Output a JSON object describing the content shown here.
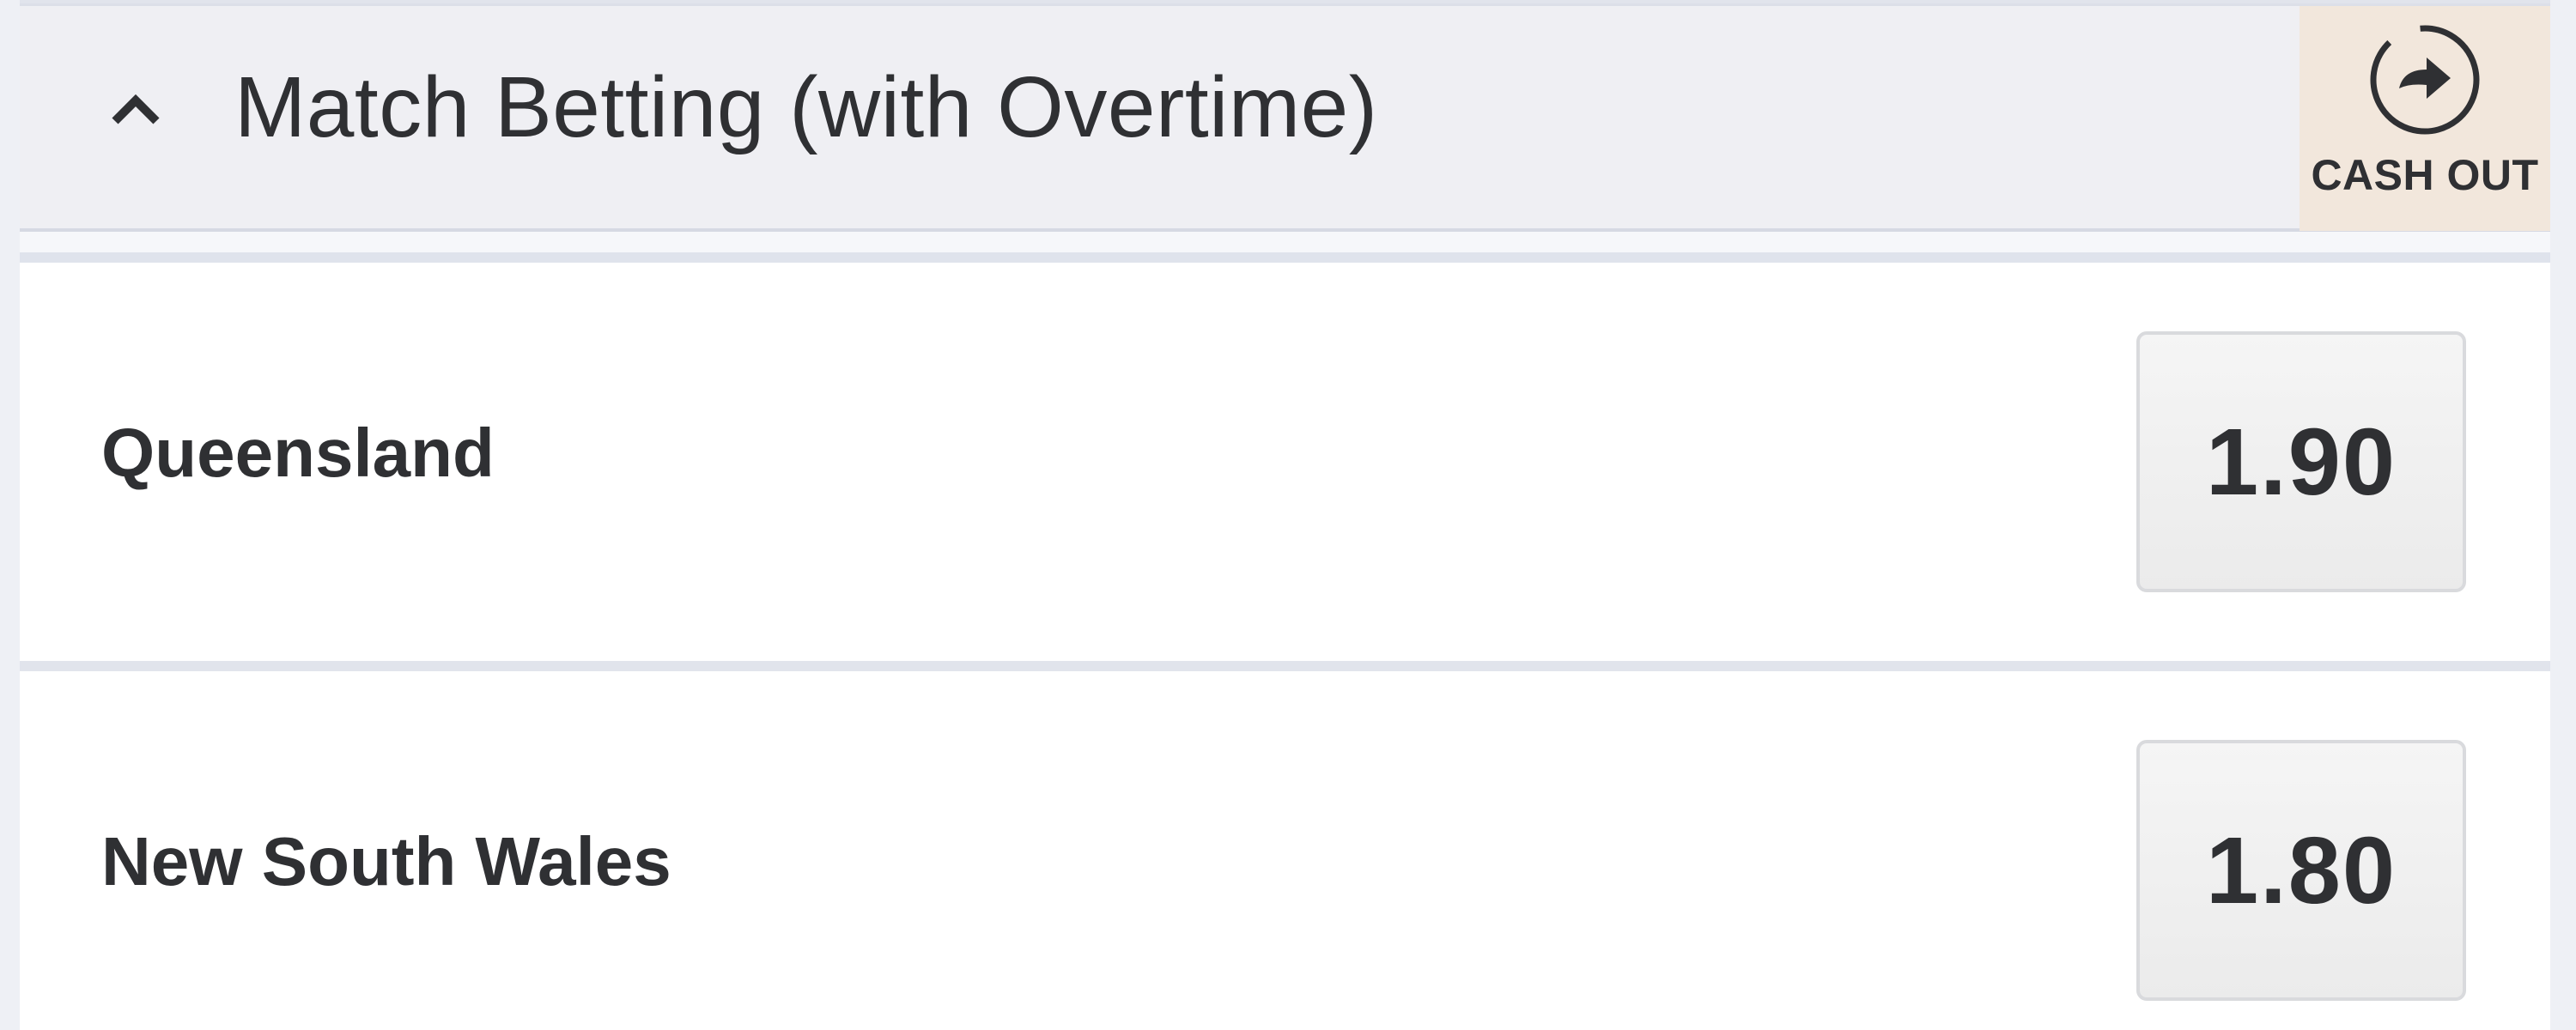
{
  "market": {
    "title": "Match Betting (with Overtime)",
    "collapse_icon": "chevron-up-icon",
    "cashout": {
      "label": "CASH OUT",
      "icon": "cashout-arrow-icon",
      "background": "#f2e7dc"
    }
  },
  "selections": [
    {
      "name": "Queensland",
      "odds": "1.90"
    },
    {
      "name": "New South Wales",
      "odds": "1.80"
    }
  ]
}
